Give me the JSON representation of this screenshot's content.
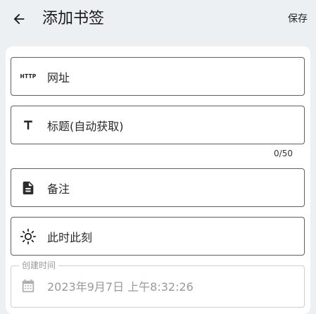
{
  "appbar": {
    "back_icon": "arrow-left-icon",
    "title": "添加书签",
    "save_label": "保存"
  },
  "form": {
    "url": {
      "icon": "http-icon",
      "icon_text": "HTTP",
      "placeholder": "网址"
    },
    "title": {
      "icon": "text-icon",
      "placeholder": "标题(自动获取)",
      "counter": "0/50"
    },
    "note": {
      "icon": "document-icon",
      "placeholder": "备注"
    },
    "moment": {
      "icon": "sun-icon",
      "label": "此时此刻"
    },
    "created": {
      "icon": "calendar-icon",
      "floating_label": "创建时间",
      "value": "2023年9月7日 上午8:32:26"
    }
  },
  "colors": {
    "background": "#edf0f3",
    "card": "#ffffff",
    "field_border": "#5f5f5f",
    "disabled_border": "#cfcfcf",
    "disabled_text": "#9a9a9a"
  }
}
